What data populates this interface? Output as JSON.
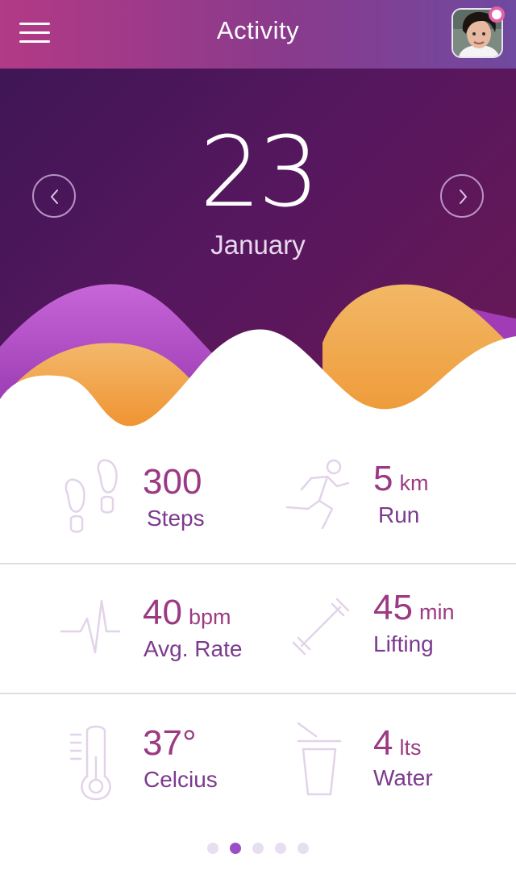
{
  "header": {
    "title": "Activity"
  },
  "date": {
    "day": "23",
    "month": "January"
  },
  "stats": {
    "steps": {
      "value": "300",
      "unit": "",
      "label": "Steps",
      "icon": "footsteps-icon"
    },
    "run": {
      "value": "5",
      "unit": "km",
      "label": "Run",
      "icon": "runner-icon"
    },
    "rate": {
      "value": "40",
      "unit": "bpm",
      "label": "Avg. Rate",
      "icon": "heartbeat-icon"
    },
    "lifting": {
      "value": "45",
      "unit": "min",
      "label": "Lifting",
      "icon": "barbell-icon"
    },
    "temperature": {
      "value": "37°",
      "unit": "",
      "label": "Celcius",
      "icon": "thermometer-icon"
    },
    "water": {
      "value": "4",
      "unit": "lts",
      "label": "Water",
      "icon": "cup-icon"
    }
  },
  "pagination": {
    "total": 5,
    "active_index": 1
  },
  "colors": {
    "accent": "#9b3a83",
    "label": "#7b3a8e",
    "icon": "#e4d7ec",
    "orange": "#f0a040",
    "purple_wave": "#c35fd0"
  }
}
